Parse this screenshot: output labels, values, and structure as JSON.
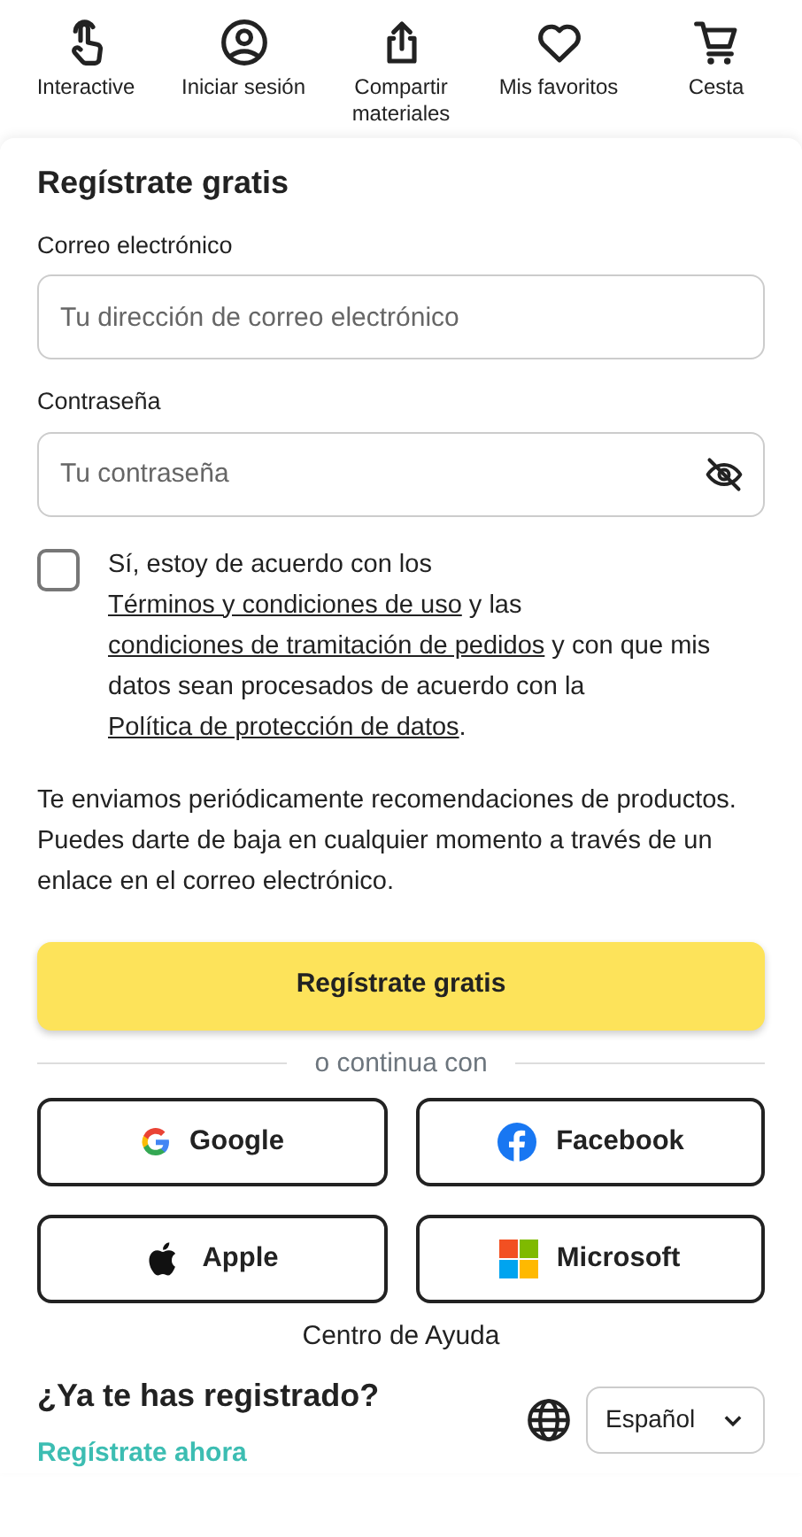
{
  "top_nav": [
    {
      "label": "Interactive",
      "kind": "touch"
    },
    {
      "label": "Iniciar sesión",
      "kind": "user"
    },
    {
      "label": "Compartir materiales",
      "kind": "share"
    },
    {
      "label": "Mis favoritos",
      "kind": "heart"
    },
    {
      "label": "Cesta",
      "kind": "cart"
    }
  ],
  "form": {
    "title": "Regístrate gratis",
    "fields": [
      {
        "label": "Correo electrónico",
        "placeholder": "Tu dirección de correo electrónico",
        "kind": "email"
      },
      {
        "label": "Contraseña",
        "placeholder": "Tu contraseña",
        "kind": "password"
      }
    ],
    "consent": {
      "checked": false,
      "parts": [
        {
          "kind": "text",
          "text": "Sí, estoy de acuerdo con los "
        },
        {
          "kind": "link",
          "text": "Términos y condiciones de uso"
        },
        {
          "kind": "text",
          "text": " y las "
        },
        {
          "kind": "link",
          "text": "condiciones de tramitación de pedidos"
        },
        {
          "kind": "text",
          "text": " y con que mis datos sean procesados de acuerdo con la "
        },
        {
          "kind": "link",
          "text": "Política de protección de datos"
        },
        {
          "kind": "text",
          "text": "."
        }
      ]
    },
    "notice": "Te enviamos periódicamente recomendaciones de productos. Puedes darte de baja en cualquier momento a través de un enlace en el correo electrónico.",
    "submit": "Regístrate gratis",
    "divider": "o continua con",
    "social": [
      {
        "label": "Google",
        "kind": "google"
      },
      {
        "label": "Facebook",
        "kind": "facebook"
      },
      {
        "label": "Apple",
        "kind": "apple"
      },
      {
        "label": "Microsoft",
        "kind": "microsoft"
      }
    ],
    "help": "Centro de Ayuda"
  },
  "footer": {
    "question": "¿Ya te has registrado?",
    "link": "Regístrate ahora",
    "language": "Español"
  }
}
